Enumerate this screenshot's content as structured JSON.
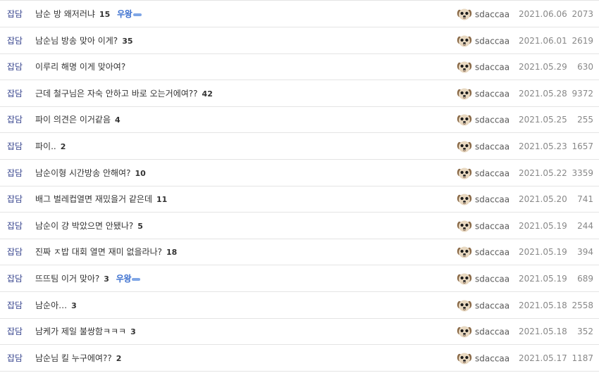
{
  "avatar_icon": "puppy-face-icon",
  "colors": {
    "category": "#3b4890",
    "badge": "#3b6fcf",
    "border": "#e4e4e4",
    "meta": "#888888"
  },
  "rows": [
    {
      "category": "잡담",
      "title": "남순 방 왜저러냐",
      "replies": "15",
      "badge": "우왕",
      "writer": "sdaccaa",
      "date": "2021.06.06",
      "views": "2073"
    },
    {
      "category": "잡담",
      "title": "남순님 방송 맞아 이게?",
      "replies": "35",
      "badge": "",
      "writer": "sdaccaa",
      "date": "2021.06.01",
      "views": "2619"
    },
    {
      "category": "잡담",
      "title": "이루리 해명 이게 맞아여?",
      "replies": "",
      "badge": "",
      "writer": "sdaccaa",
      "date": "2021.05.29",
      "views": "630"
    },
    {
      "category": "잡담",
      "title": "근데 철구님은 자숙 안하고 바로 오는거에여??",
      "replies": "42",
      "badge": "",
      "writer": "sdaccaa",
      "date": "2021.05.28",
      "views": "9372"
    },
    {
      "category": "잡담",
      "title": "파이 의견은 이거같음",
      "replies": "4",
      "badge": "",
      "writer": "sdaccaa",
      "date": "2021.05.25",
      "views": "255"
    },
    {
      "category": "잡담",
      "title": "파이..",
      "replies": "2",
      "badge": "",
      "writer": "sdaccaa",
      "date": "2021.05.23",
      "views": "1657"
    },
    {
      "category": "잡담",
      "title": "남순이형 시간방송 안해여?",
      "replies": "10",
      "badge": "",
      "writer": "sdaccaa",
      "date": "2021.05.22",
      "views": "3359"
    },
    {
      "category": "잡담",
      "title": "배그 벌레컵열면 재밌을거 같은데",
      "replies": "11",
      "badge": "",
      "writer": "sdaccaa",
      "date": "2021.05.20",
      "views": "741"
    },
    {
      "category": "잡담",
      "title": "남순이 걍 박았으면 안됐나?",
      "replies": "5",
      "badge": "",
      "writer": "sdaccaa",
      "date": "2021.05.19",
      "views": "244"
    },
    {
      "category": "잡담",
      "title": "진짜 ㅈ밥 대회 열면 재미 없을라나?",
      "replies": "18",
      "badge": "",
      "writer": "sdaccaa",
      "date": "2021.05.19",
      "views": "394"
    },
    {
      "category": "잡담",
      "title": "뜨뜨팀 이거 맞아?",
      "replies": "3",
      "badge": "우왕",
      "writer": "sdaccaa",
      "date": "2021.05.19",
      "views": "689"
    },
    {
      "category": "잡담",
      "title": "남순아…",
      "replies": "3",
      "badge": "",
      "writer": "sdaccaa",
      "date": "2021.05.18",
      "views": "2558"
    },
    {
      "category": "잡담",
      "title": "남케가 제일 불쌍함ㅋㅋㅋ",
      "replies": "3",
      "badge": "",
      "writer": "sdaccaa",
      "date": "2021.05.18",
      "views": "352"
    },
    {
      "category": "잡담",
      "title": "남순님 킬 누구에여??",
      "replies": "2",
      "badge": "",
      "writer": "sdaccaa",
      "date": "2021.05.17",
      "views": "1187"
    }
  ]
}
